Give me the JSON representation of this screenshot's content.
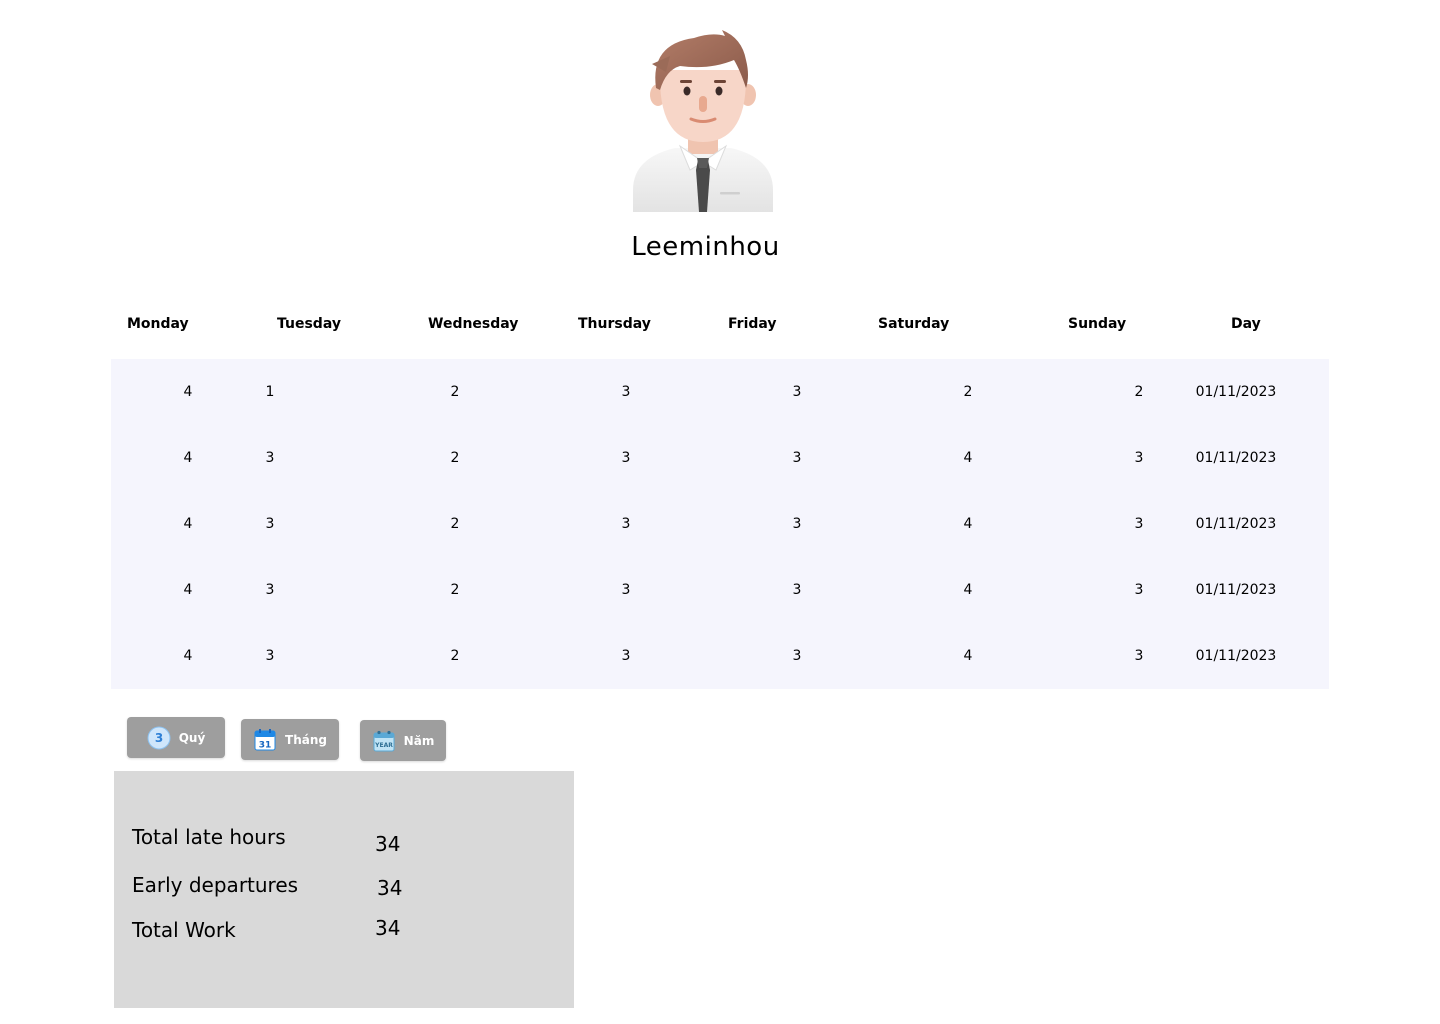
{
  "profile": {
    "name": "Leeminhou",
    "avatar_icon": "businessman-avatar-icon"
  },
  "schedule": {
    "columns": [
      "Monday",
      "Tuesday",
      "Wednesday",
      "Thursday",
      "Friday",
      "Saturday",
      "Sunday",
      "Day"
    ],
    "rows": [
      [
        "4",
        "1",
        "2",
        "3",
        "3",
        "2",
        "2",
        "01/11/2023"
      ],
      [
        "4",
        "3",
        "2",
        "3",
        "3",
        "4",
        "3",
        "01/11/2023"
      ],
      [
        "4",
        "3",
        "2",
        "3",
        "3",
        "4",
        "3",
        "01/11/2023"
      ],
      [
        "4",
        "3",
        "2",
        "3",
        "3",
        "4",
        "3",
        "01/11/2023"
      ],
      [
        "4",
        "3",
        "2",
        "3",
        "3",
        "4",
        "3",
        "01/11/2023"
      ]
    ]
  },
  "period_buttons": {
    "quarter": {
      "icon": "quarter-badge-icon",
      "icon_text": "3",
      "label": "Quý"
    },
    "month": {
      "icon": "calendar-icon",
      "icon_text": "31",
      "label": "Tháng"
    },
    "year": {
      "icon": "year-calendar-icon",
      "icon_text": "YEAR",
      "label": "Năm"
    }
  },
  "summary": {
    "late_label": "Total late hours",
    "late_value": "34",
    "early_label": "Early departures",
    "early_value": "34",
    "work_label": "Total Work",
    "work_value": "34"
  },
  "colors": {
    "table_background": "#f5f5fd",
    "button_background": "#9e9e9e",
    "summary_background": "#d9d9d9"
  }
}
